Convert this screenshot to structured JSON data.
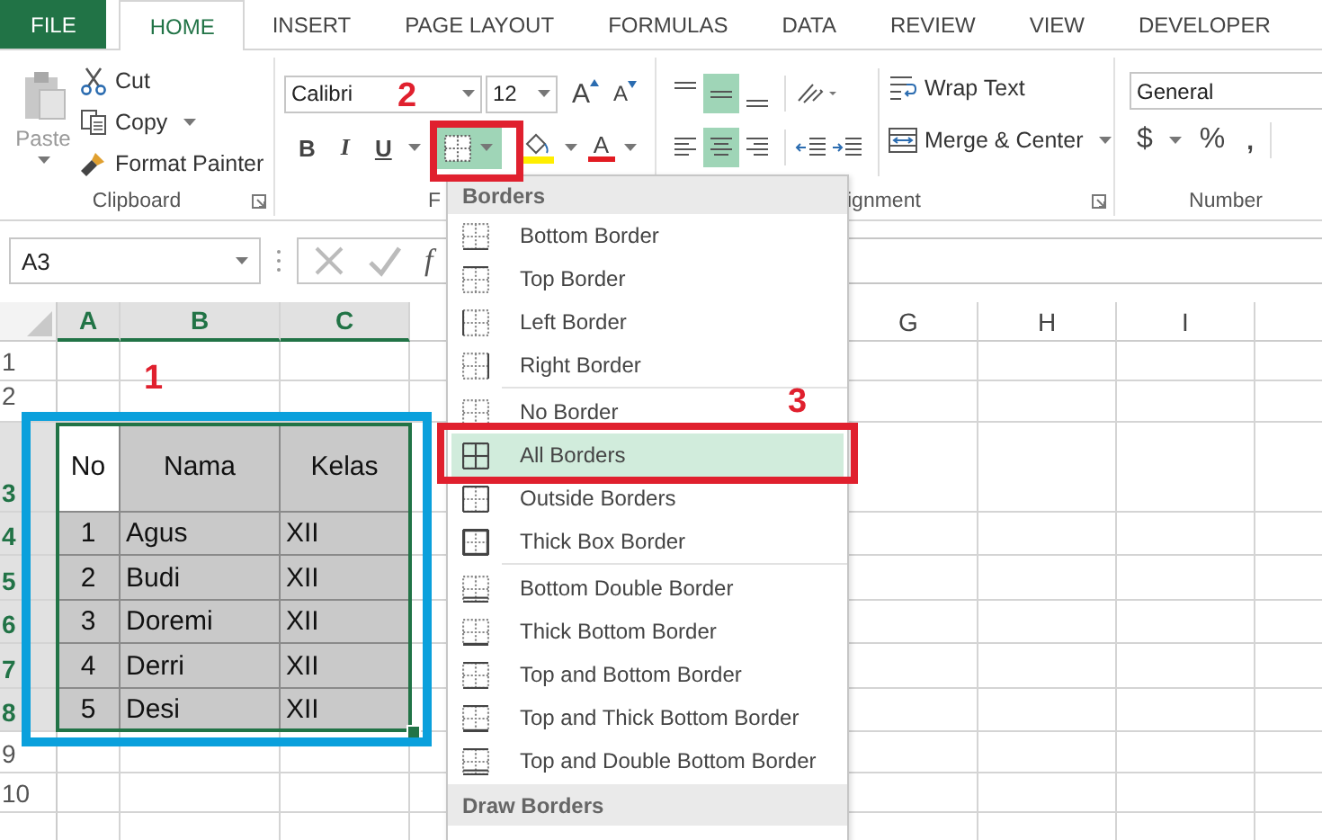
{
  "tabs": [
    {
      "label": "FILE",
      "kind": "backstage",
      "selected": false
    },
    {
      "label": "HOME",
      "kind": "tab",
      "selected": true
    },
    {
      "label": "INSERT",
      "kind": "tab",
      "selected": false
    },
    {
      "label": "PAGE LAYOUT",
      "kind": "tab",
      "selected": false
    },
    {
      "label": "FORMULAS",
      "kind": "tab",
      "selected": false
    },
    {
      "label": "DATA",
      "kind": "tab",
      "selected": false
    },
    {
      "label": "REVIEW",
      "kind": "tab",
      "selected": false
    },
    {
      "label": "VIEW",
      "kind": "tab",
      "selected": false
    },
    {
      "label": "DEVELOPER",
      "kind": "tab",
      "selected": false
    }
  ],
  "clipboard": {
    "paste": "Paste",
    "cut": "Cut",
    "copy": "Copy",
    "format_painter": "Format Painter",
    "label": "Clipboard"
  },
  "font": {
    "name": "Calibri",
    "size": "12",
    "grow": "A",
    "shrink": "A",
    "bold": "B",
    "italic": "I",
    "underline": "U",
    "font_color": "A",
    "borders_selected": true,
    "label": "F"
  },
  "alignment": {
    "vertical": [
      {
        "kind": "top",
        "selected": false
      },
      {
        "kind": "middle",
        "selected": true
      },
      {
        "kind": "bottom",
        "selected": false
      }
    ],
    "horizontal": [
      {
        "kind": "left",
        "selected": false
      },
      {
        "kind": "center",
        "selected": true
      },
      {
        "kind": "right",
        "selected": false
      }
    ],
    "wrap_text": "Wrap Text",
    "merge": "Merge & Center",
    "label": "ignment"
  },
  "number": {
    "format": "General",
    "currency": "$",
    "percent": "%",
    "comma": ",",
    "label": "Number"
  },
  "formula_bar": {
    "name_box": "A3",
    "fx": "f"
  },
  "sheet": {
    "columns": [
      {
        "label": "A",
        "selected": true
      },
      {
        "label": "B",
        "selected": true
      },
      {
        "label": "C",
        "selected": true
      },
      {
        "label": "G",
        "selected": false
      },
      {
        "label": "H",
        "selected": false
      },
      {
        "label": "I",
        "selected": false
      }
    ],
    "rows": [
      {
        "header": "1",
        "selected": false,
        "cells": []
      },
      {
        "header": "2",
        "selected": false,
        "cells": []
      },
      {
        "header": "3",
        "selected": true,
        "cells": [
          {
            "text": "No",
            "shaded": false
          },
          {
            "text": "Nama",
            "shaded": true
          },
          {
            "text": "Kelas",
            "shaded": true
          }
        ]
      },
      {
        "header": "4",
        "selected": true,
        "cells": [
          {
            "text": "1",
            "shaded": true
          },
          {
            "text": "Agus",
            "shaded": true
          },
          {
            "text": "XII",
            "shaded": true
          }
        ]
      },
      {
        "header": "5",
        "selected": true,
        "cells": [
          {
            "text": "2",
            "shaded": true
          },
          {
            "text": "Budi",
            "shaded": true
          },
          {
            "text": "XII",
            "shaded": true
          }
        ]
      },
      {
        "header": "6",
        "selected": true,
        "cells": [
          {
            "text": "3",
            "shaded": true
          },
          {
            "text": "Doremi",
            "shaded": true
          },
          {
            "text": "XII",
            "shaded": true
          }
        ]
      },
      {
        "header": "7",
        "selected": true,
        "cells": [
          {
            "text": "4",
            "shaded": true
          },
          {
            "text": "Derri",
            "shaded": true
          },
          {
            "text": "XII",
            "shaded": true
          }
        ]
      },
      {
        "header": "8",
        "selected": true,
        "cells": [
          {
            "text": "5",
            "shaded": true
          },
          {
            "text": "Desi",
            "shaded": true
          },
          {
            "text": "XII",
            "shaded": true
          }
        ]
      },
      {
        "header": "9",
        "selected": false,
        "cells": []
      },
      {
        "header": "10",
        "selected": false,
        "cells": []
      },
      {
        "selected": false,
        "cells": []
      }
    ]
  },
  "borders_menu": {
    "title": "Borders",
    "sections": [
      {
        "items": [
          {
            "label": "Bottom Border",
            "kind": "bottom",
            "selected": false
          },
          {
            "label": "Top Border",
            "kind": "top",
            "selected": false
          },
          {
            "label": "Left Border",
            "kind": "left",
            "selected": false
          },
          {
            "label": "Right Border",
            "kind": "right",
            "selected": false
          }
        ]
      },
      {
        "items": [
          {
            "label": "No Border",
            "kind": "none",
            "selected": false
          },
          {
            "label": "All Borders",
            "kind": "all",
            "selected": true
          },
          {
            "label": "Outside Borders",
            "kind": "outside",
            "selected": false
          },
          {
            "label": "Thick Box Border",
            "kind": "thick_box",
            "selected": false
          }
        ]
      },
      {
        "items": [
          {
            "label": "Bottom Double Border",
            "kind": "bottom_double",
            "selected": false
          },
          {
            "label": "Thick Bottom Border",
            "kind": "thick_bottom",
            "selected": false
          },
          {
            "label": "Top and Bottom Border",
            "kind": "top_bottom",
            "selected": false
          },
          {
            "label": "Top and Thick Bottom Border",
            "kind": "top_thick_bottom",
            "selected": false
          },
          {
            "label": "Top and Double Bottom Border",
            "kind": "top_double_bottom",
            "selected": false
          }
        ]
      }
    ],
    "draw_title": "Draw Borders"
  },
  "annotations": [
    {
      "label": "1"
    },
    {
      "label": "2"
    },
    {
      "label": "3"
    }
  ]
}
